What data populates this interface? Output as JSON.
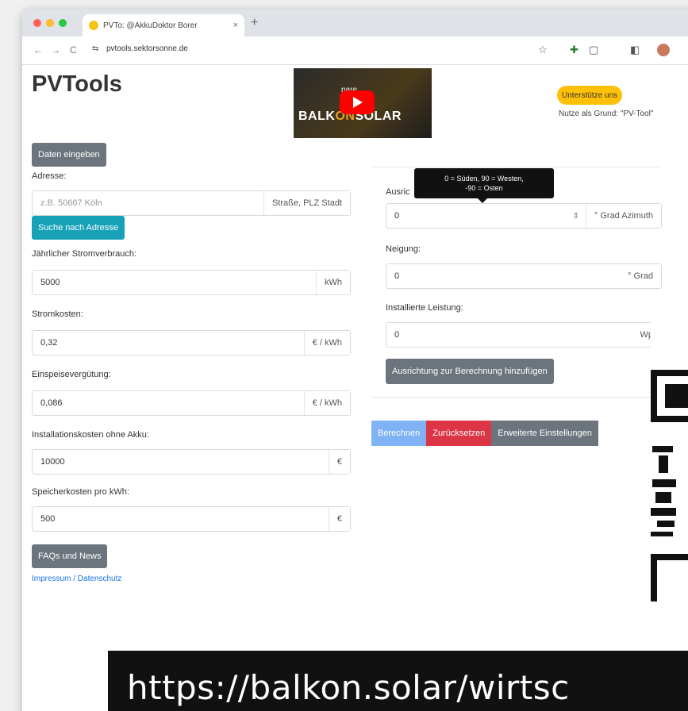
{
  "browser": {
    "tab_title": "PVTo: @AkkuDoktor Borer",
    "tab_close": "×",
    "new_tab": "+",
    "tab_menu": "⌄",
    "url": "pvtools.sektorsonne.de",
    "back": "←",
    "forward": "→",
    "reload": "C",
    "site_info": "⇆",
    "icons": [
      "star-icon",
      "extensions-icon",
      "reader-icon",
      "sidepanel-icon",
      "profile-avatar"
    ]
  },
  "header": {
    "brand": "PVTools",
    "video_caption": "pare ...",
    "video_brand_left": "BALK",
    "video_brand_mid": "ON",
    "video_brand_right": "SOLAR",
    "support_button": "Unterstütze uns",
    "support_note": "Nutze als Grund: \"PV-Tool\""
  },
  "left": {
    "data_button": "Daten eingeben",
    "address_label": "Adresse:",
    "address_placeholder": "z.B. 50667 Köln",
    "address_addon": "Straße, PLZ Stadt",
    "search_button": "Suche nach Adresse",
    "consumption_label": "Jährlicher Stromverbrauch:",
    "consumption_value": "5000",
    "consumption_unit": "kWh",
    "cost_label": "Stromkosten:",
    "cost_value": "0,32",
    "cost_unit": "€ / kWh",
    "feedin_label": "Einspeisevergütung:",
    "feedin_value": "0,086",
    "feedin_unit": "€ / kWh",
    "install_label": "Installationskosten ohne Akku:",
    "install_value": "10000",
    "install_unit": "€",
    "storage_label": "Speicherkosten pro kWh:",
    "storage_value": "500",
    "storage_unit": "€",
    "faq_button": "FAQs und News",
    "impressum_link": "Impressum / Datenschutz"
  },
  "right": {
    "tooltip_line1": "0 = Süden, 90 = Westen,",
    "tooltip_line2": "-90 = Osten",
    "orientation_label": "Ausric",
    "orientation_value": "0",
    "orientation_spin": "⇕",
    "orientation_unit": "° Grad Azimuth",
    "tilt_label": "Neigung:",
    "tilt_value": "0",
    "tilt_unit": "° Grad",
    "power_label": "Installierte Leistung:",
    "power_value": "0",
    "power_unit": "Wp",
    "add_button": "Ausrichtung zur Berechnung hinzufügen",
    "calc_button": "Berechnen",
    "reset_button": "Zurücksetzen",
    "advanced_button": "Erweiterte Einstellungen"
  },
  "overlay": {
    "banner_text": "https://balkon.solar/wirtsc"
  },
  "colors": {
    "gray_button": "#6c757d",
    "teal_button": "#17a2b8",
    "support_yellow": "#ffc107",
    "reset_red": "#dc3545",
    "calc_blue": "#7fb3f5",
    "link_blue": "#1a73e8"
  }
}
